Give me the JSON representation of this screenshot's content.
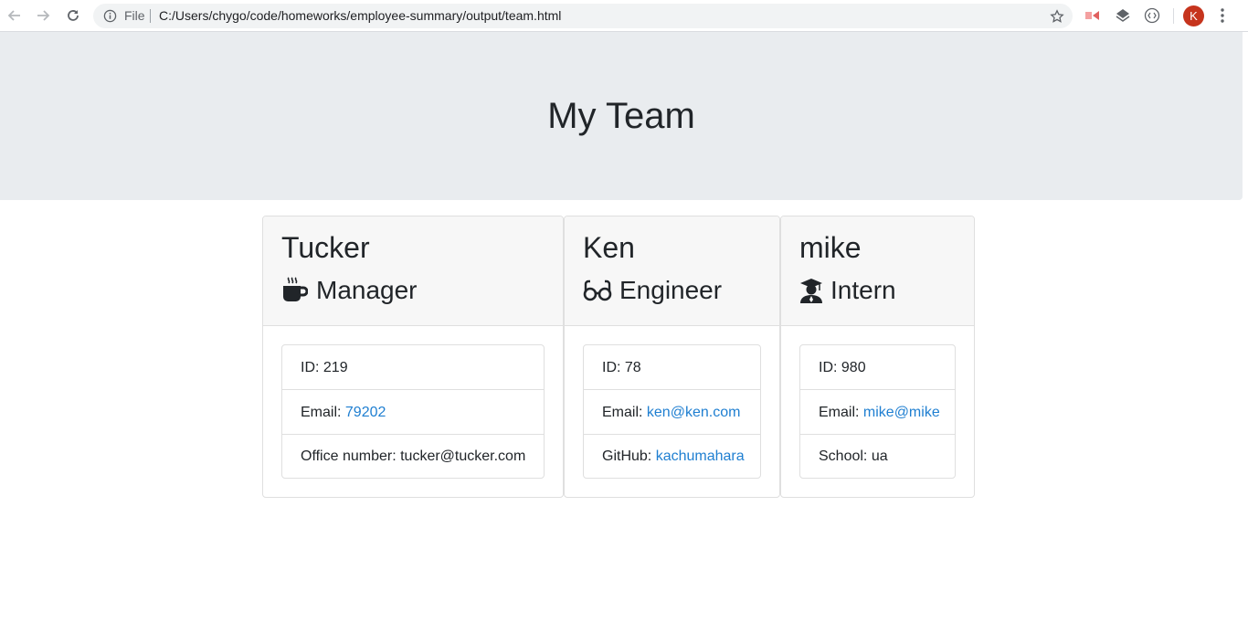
{
  "browser": {
    "url_scheme": "File",
    "url": "C:/Users/chygo/code/homeworks/employee-summary/output/team.html",
    "profile_initial": "K",
    "icons": [
      "back-arrow-icon",
      "forward-arrow-icon",
      "reload-icon",
      "info-icon",
      "star-icon",
      "cast-extension-icon",
      "layers-extension-icon",
      "code-extension-icon",
      "more-vert-icon"
    ]
  },
  "page": {
    "title": "My Team"
  },
  "team": [
    {
      "name": "Tucker",
      "role": "Manager",
      "icon": "mug-icon",
      "id_label": "ID: ",
      "id": "219",
      "email_label": "Email: ",
      "email": "79202",
      "extra_label": "Office number: ",
      "extra": "tucker@tucker.com"
    },
    {
      "name": "Ken",
      "role": "Engineer",
      "icon": "glasses-icon",
      "id_label": "ID: ",
      "id": "78",
      "email_label": "Email: ",
      "email": "ken@ken.com",
      "extra_label": "GitHub: ",
      "extra": "kachumahara"
    },
    {
      "name": "mike",
      "role": "Intern",
      "icon": "graduate-icon",
      "id_label": "ID: ",
      "id": "980",
      "email_label": "Email: ",
      "email": "mike@mike",
      "extra_label": "School: ",
      "extra": "ua"
    }
  ],
  "colors": {
    "jumbotron": "#e9ecef",
    "link": "#1f7fd1",
    "avatar": "#c6341d"
  }
}
